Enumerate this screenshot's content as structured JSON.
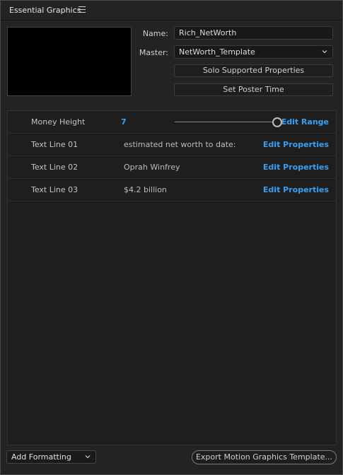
{
  "panel": {
    "title": "Essential Graphics",
    "menu_icon": "hamburger-menu-icon"
  },
  "properties": {
    "name_label": "Name:",
    "name_value": "Rich_NetWorth",
    "master_label": "Master:",
    "master_value": "NetWorth_Template",
    "solo_button": "Solo Supported Properties",
    "poster_button": "Set Poster Time"
  },
  "rows": [
    {
      "name": "Money Height",
      "value": "7",
      "slider_level": 1.0,
      "link": "Edit Range"
    },
    {
      "name": "Text Line 01",
      "value": "estimated net worth to date:",
      "link": "Edit Properties"
    },
    {
      "name": "Text Line 02",
      "value": "Oprah Winfrey",
      "link": "Edit Properties"
    },
    {
      "name": "Text Line 03",
      "value": "$4.2 billion",
      "link": "Edit Properties"
    }
  ],
  "footer": {
    "formatting_dropdown": "Add Formatting",
    "export_button": "Export Motion Graphics Template..."
  },
  "colors": {
    "accent_blue": "#3aa0f5",
    "panel_bg": "#232323"
  }
}
